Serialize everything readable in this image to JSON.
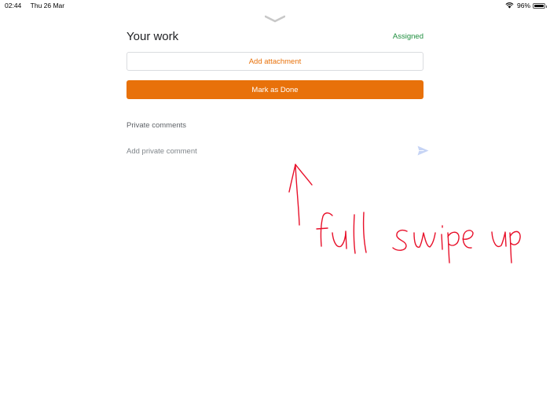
{
  "status_bar": {
    "time": "02:44",
    "date": "Thu 26 Mar",
    "battery": "96%",
    "battery_level": 0.96
  },
  "icons": {
    "handle": "chevron-down-icon",
    "send": "send-icon",
    "wifi": "wifi-icon",
    "battery": "battery-icon"
  },
  "header": {
    "title": "Your work",
    "status": "Assigned"
  },
  "actions": {
    "attach_label": "Add attachment",
    "done_label": "Mark as Done"
  },
  "comments": {
    "section_label": "Private comments",
    "placeholder": "Add private comment",
    "value": ""
  },
  "annotation": {
    "text": "full swipe up"
  },
  "colors": {
    "accent": "#e8710a",
    "status_green": "#1e8e3e",
    "annotation_red": "#e8102a",
    "send_disabled": "#c6d4f5"
  }
}
